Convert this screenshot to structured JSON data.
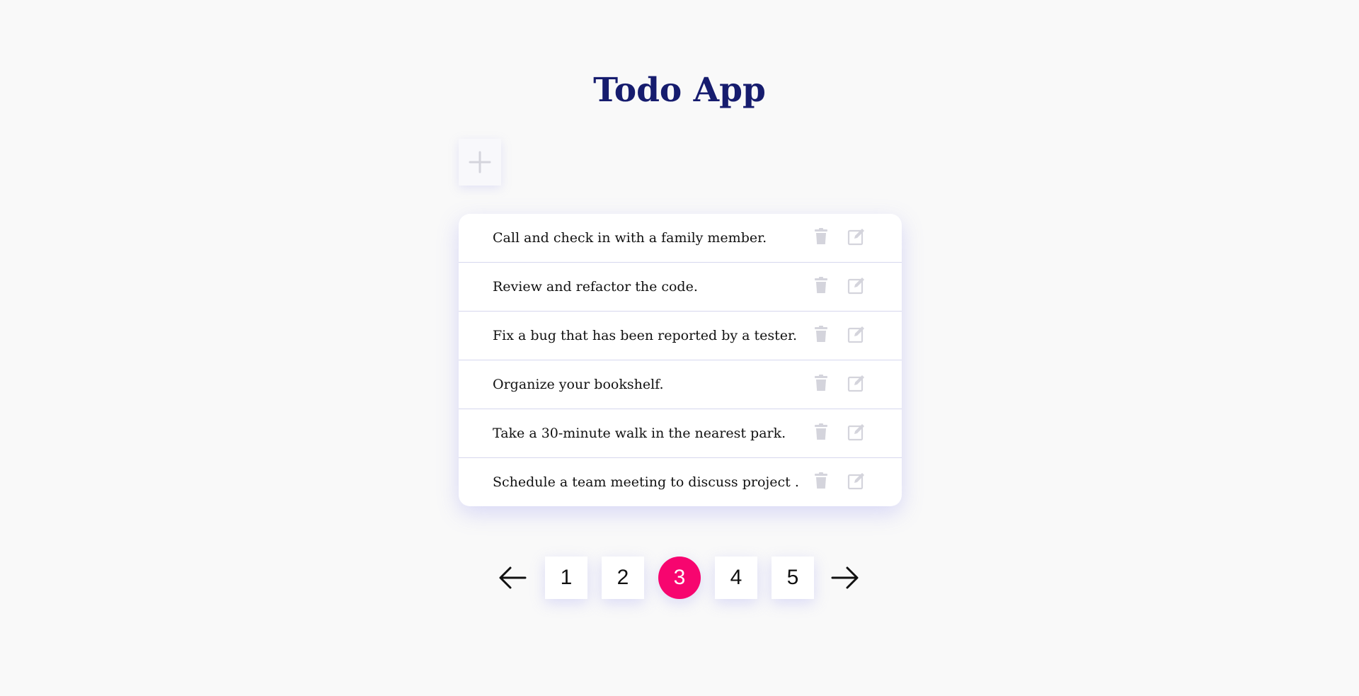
{
  "app": {
    "title": "Todo App"
  },
  "toolbar": {
    "add_icon": "plus-icon"
  },
  "todos": [
    {
      "text": "Call and check in with a family member."
    },
    {
      "text": "Review and refactor the code."
    },
    {
      "text": "Fix a bug that has been reported by a tester."
    },
    {
      "text": "Organize your bookshelf."
    },
    {
      "text": "Take a 30-minute walk in the nearest park."
    },
    {
      "text": "Schedule a team meeting to discuss project ."
    }
  ],
  "row_icons": {
    "delete": "trash-icon",
    "edit": "edit-icon"
  },
  "pagination": {
    "prev_icon": "arrow-left-icon",
    "next_icon": "arrow-right-icon",
    "pages": [
      "1",
      "2",
      "3",
      "4",
      "5"
    ],
    "current_page": "3"
  },
  "colors": {
    "title": "#161c6e",
    "active_page": "#f7056f",
    "icon_muted": "#d4d4dc",
    "background": "#f9f9f9"
  }
}
